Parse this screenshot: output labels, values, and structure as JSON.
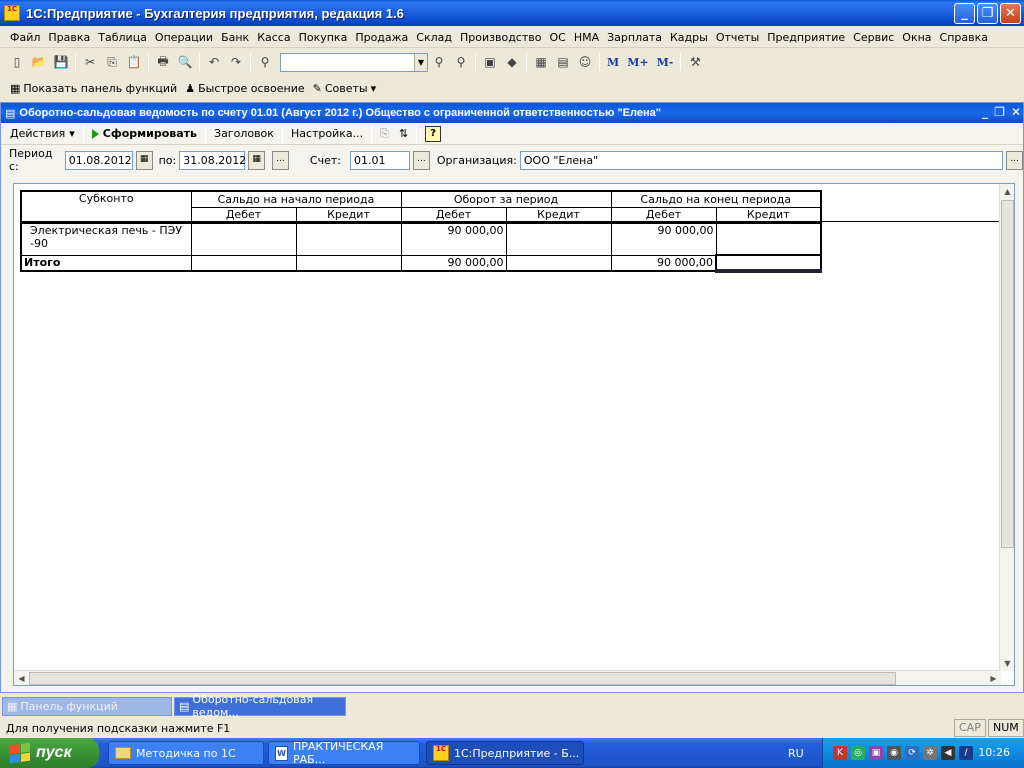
{
  "app": {
    "title": "1С:Предприятие - Бухгалтерия предприятия, редакция 1.6",
    "icon_text": "1C"
  },
  "menu": [
    "Файл",
    "Правка",
    "Таблица",
    "Операции",
    "Банк",
    "Касса",
    "Покупка",
    "Продажа",
    "Склад",
    "Производство",
    "ОС",
    "НМА",
    "Зарплата",
    "Кадры",
    "Отчеты",
    "Предприятие",
    "Сервис",
    "Окна",
    "Справка"
  ],
  "toolbar2": {
    "show_panel": "Показать панель функций",
    "quick_learn": "Быстрое освоение",
    "tips": "Советы"
  },
  "toolbar1": {
    "m": "M",
    "mplus": "M+",
    "mminus": "M-"
  },
  "document": {
    "title": "Оборотно-сальдовая ведомость по счету 01.01 (Август 2012 г.) Общество с ограниченной ответственностью \"Елена\"",
    "actions": "Действия",
    "generate": "Сформировать",
    "header": "Заголовок",
    "settings": "Настройка...",
    "help": "?"
  },
  "params": {
    "period_from_label": "Период с:",
    "period_from": "01.08.2012",
    "period_to_label": "по:",
    "period_to": "31.08.2012",
    "ellipsis": "...",
    "account_label": "Счет:",
    "account": "01.01",
    "org_label": "Организация:",
    "org": "ООО \"Елена\""
  },
  "report": {
    "headers": {
      "subkonto": "Субконто",
      "start_balance": "Сальдо на начало периода",
      "turnover": "Оборот за период",
      "end_balance": "Сальдо на конец периода",
      "debit": "Дебет",
      "credit": "Кредит"
    },
    "row": {
      "name_line1": "Электрическая печь - ПЭУ",
      "name_line2": "-90",
      "start_debit": "",
      "start_credit": "",
      "turn_debit": "90 000,00",
      "turn_credit": "",
      "end_debit": "90 000,00",
      "end_credit": ""
    },
    "total": {
      "label": "Итого",
      "start_debit": "",
      "start_credit": "",
      "turn_debit": "90 000,00",
      "turn_credit": "",
      "end_debit": "90 000,00",
      "end_credit": ""
    }
  },
  "tabs": {
    "panel": "Панель функций",
    "report": "Оборотно-сальдовая ведом..."
  },
  "status": {
    "hint": "Для получения подсказки нажмите F1",
    "cap": "CAP",
    "num": "NUM"
  },
  "taskbar": {
    "start": "пуск",
    "task1": "Методичка по 1С",
    "task2": "ПРАКТИЧЕСКАЯ РАБ...",
    "task3": "1С:Предприятие - Б...",
    "lang": "RU",
    "clock": "10:26"
  }
}
